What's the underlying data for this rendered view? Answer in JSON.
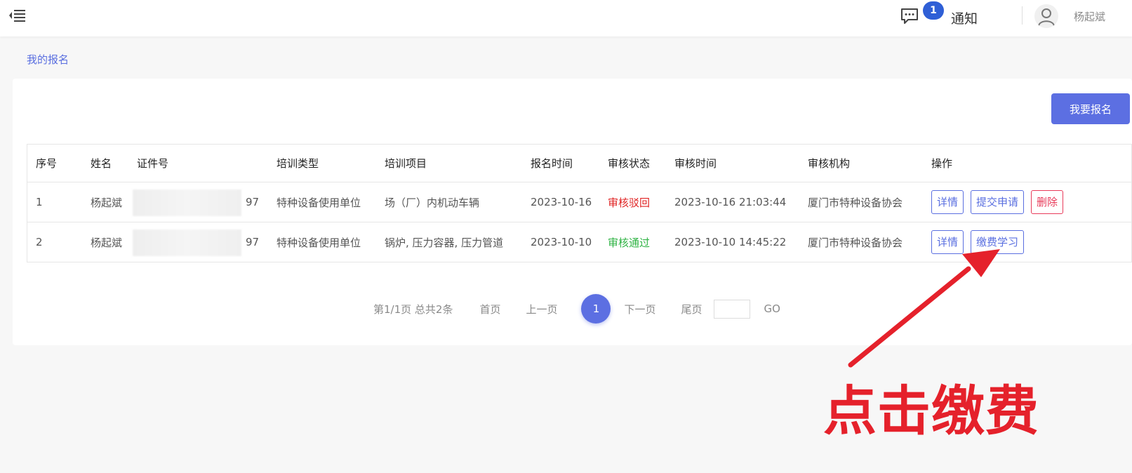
{
  "header": {
    "menu_icon": "menu-collapse-icon",
    "message_icon": "chat-bubble-icon",
    "notification_count": "1",
    "notification_label": "通知",
    "avatar_icon": "user-avatar-icon",
    "user_name": "杨起斌"
  },
  "breadcrumb": "我的报名",
  "toolbar": {
    "register_label": "我要报名"
  },
  "table": {
    "columns": [
      "序号",
      "姓名",
      "证件号",
      "培训类型",
      "培训项目",
      "报名时间",
      "审核状态",
      "审核时间",
      "审核机构",
      "操作"
    ],
    "rows": [
      {
        "index": "1",
        "name": "杨起斌",
        "id_suffix": "97",
        "training_type": "特种设备使用单位",
        "training_item": "场（厂）内机动车辆",
        "register_time": "2023-10-16",
        "status": "审核驳回",
        "review_time": "2023-10-16 21:03:44",
        "agency": "厦门市特种设备协会",
        "actions": [
          "详情",
          "提交申请",
          "删除"
        ]
      },
      {
        "index": "2",
        "name": "杨起斌",
        "id_suffix": "97",
        "training_type": "特种设备使用单位",
        "training_item": "锅炉, 压力容器, 压力管道",
        "register_time": "2023-10-10",
        "status": "审核通过",
        "review_time": "2023-10-10 14:45:22",
        "agency": "厦门市特种设备协会",
        "actions": [
          "详情",
          "缴费学习"
        ]
      }
    ]
  },
  "pagination": {
    "summary": "第1/1页 总共2条",
    "first": "首页",
    "prev": "上一页",
    "current": "1",
    "next": "下一页",
    "last": "尾页",
    "go": "GO"
  },
  "annotation": {
    "text": "点击缴费",
    "color": "#e5212b"
  },
  "colors": {
    "primary": "#5c6fe2",
    "reject": "#e02424",
    "pass": "#2fb344",
    "danger": "#e83b5a"
  }
}
